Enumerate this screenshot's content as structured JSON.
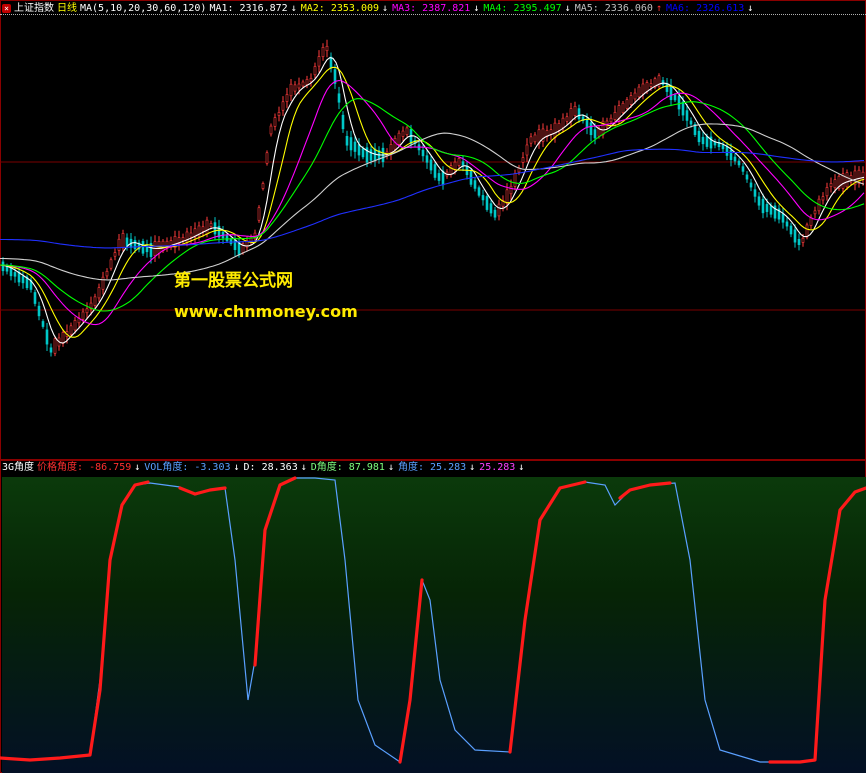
{
  "main_legend": {
    "index_name": "上证指数",
    "period": "日线",
    "ma_params": "MA(5,10,20,30,60,120)",
    "items": [
      {
        "label": "MA1:",
        "value": "2316.872",
        "arrow": "↓",
        "color": "#ffffff"
      },
      {
        "label": "MA2:",
        "value": "2353.009",
        "arrow": "↓",
        "color": "#ffff00"
      },
      {
        "label": "MA3:",
        "value": "2387.821",
        "arrow": "↓",
        "color": "#ff00ff"
      },
      {
        "label": "MA4:",
        "value": "2395.497",
        "arrow": "↓",
        "color": "#00ff00"
      },
      {
        "label": "MA5:",
        "value": "2336.060",
        "arrow": "↑",
        "color": "#c0c0c0"
      },
      {
        "label": "MA6:",
        "value": "2326.613",
        "arrow": "↓",
        "color": "#0000ff"
      }
    ]
  },
  "sub_legend": {
    "name": "3G角度",
    "items": [
      {
        "label": "价格角度:",
        "value": "-86.759",
        "arrow": "↓",
        "color": "#ff3030"
      },
      {
        "label": "VOL角度:",
        "value": "-3.303",
        "arrow": "↓",
        "color": "#5aa0ff"
      },
      {
        "label": "D:",
        "value": "28.363",
        "arrow": "↓",
        "color": "#ffffff"
      },
      {
        "label": "D角度:",
        "value": "87.981",
        "arrow": "↓",
        "color": "#7fff7f"
      },
      {
        "label": "角度:",
        "value": "25.283",
        "arrow": "↓",
        "color": "#5aa0ff"
      },
      {
        "label": "",
        "value": "25.283",
        "arrow": "↓",
        "color": "#ff40ff"
      }
    ]
  },
  "watermark": {
    "title": "第一股票公式网",
    "url": "www.chnmoney.com"
  },
  "colors": {
    "up_candle": "#ff3c3c",
    "down_candle": "#00c8c8",
    "angle_red": "#ff1a1a",
    "angle_blue": "#5aa0ff"
  }
}
